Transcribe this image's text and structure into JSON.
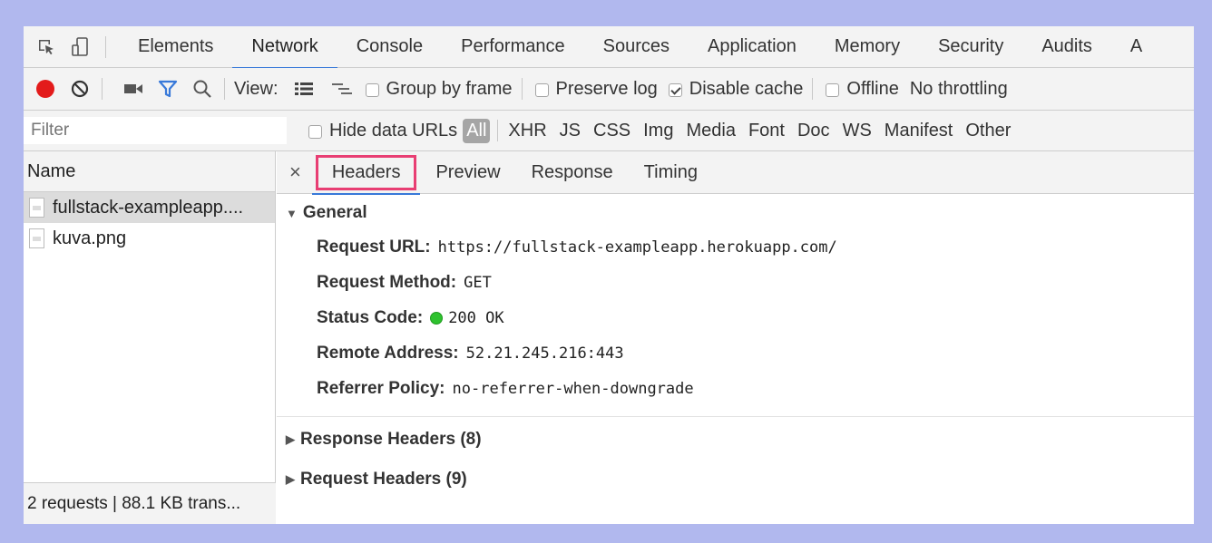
{
  "main_tabs": {
    "items": [
      {
        "label": "Elements",
        "active": false
      },
      {
        "label": "Network",
        "active": true
      },
      {
        "label": "Console",
        "active": false
      },
      {
        "label": "Performance",
        "active": false
      },
      {
        "label": "Sources",
        "active": false
      },
      {
        "label": "Application",
        "active": false
      },
      {
        "label": "Memory",
        "active": false
      },
      {
        "label": "Security",
        "active": false
      },
      {
        "label": "Audits",
        "active": false
      },
      {
        "label": "A",
        "active": false
      }
    ]
  },
  "toolbar": {
    "view_label": "View:",
    "group_by_frame": {
      "label": "Group by frame",
      "checked": false
    },
    "preserve_log": {
      "label": "Preserve log",
      "checked": false
    },
    "disable_cache": {
      "label": "Disable cache",
      "checked": true
    },
    "offline": {
      "label": "Offline",
      "checked": false
    },
    "throttling": "No throttling",
    "record_color": "#e31b1b",
    "filter_icon_color": "#3879d9"
  },
  "filterbar": {
    "placeholder": "Filter",
    "hide_data_urls": {
      "label": "Hide data URLs",
      "checked": false
    },
    "types": [
      "All",
      "XHR",
      "JS",
      "CSS",
      "Img",
      "Media",
      "Font",
      "Doc",
      "WS",
      "Manifest",
      "Other"
    ]
  },
  "request_list": {
    "header": "Name",
    "items": [
      {
        "name": "fullstack-exampleapp....",
        "selected": true
      },
      {
        "name": "kuva.png",
        "selected": false
      }
    ],
    "footer": "2 requests | 88.1 KB trans..."
  },
  "detail_tabs": {
    "close": "×",
    "items": [
      {
        "label": "Headers",
        "active": true
      },
      {
        "label": "Preview",
        "active": false
      },
      {
        "label": "Response",
        "active": false
      },
      {
        "label": "Timing",
        "active": false
      }
    ]
  },
  "general": {
    "title": "General",
    "rows": [
      {
        "key": "Request URL:",
        "value": "https://fullstack-exampleapp.herokuapp.com/"
      },
      {
        "key": "Request Method:",
        "value": "GET"
      },
      {
        "key": "Status Code:",
        "value": "200 OK"
      },
      {
        "key": "Remote Address:",
        "value": "52.21.245.216:443"
      },
      {
        "key": "Referrer Policy:",
        "value": "no-referrer-when-downgrade"
      }
    ]
  },
  "response_headers": {
    "title": "Response Headers (8)"
  },
  "request_headers": {
    "title": "Request Headers (9)"
  },
  "colors": {
    "accent": "#3879d9",
    "highlight_box": "#e83e73",
    "status_ok": "#2ec22e"
  }
}
